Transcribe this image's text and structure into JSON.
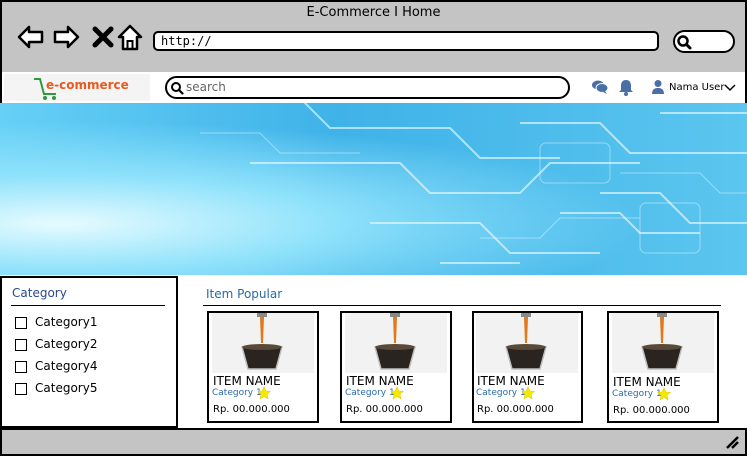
{
  "window": {
    "title": "E-Commerce I Home"
  },
  "browser": {
    "url": "http://",
    "nav_icons": [
      "back-icon",
      "forward-icon",
      "close-icon",
      "home-icon"
    ]
  },
  "header": {
    "logo_text": "e-commerce",
    "search_placeholder": "search",
    "user_name": "Nama User",
    "icons": [
      "chat-icon",
      "bell-icon",
      "user-icon",
      "chevron-down-icon"
    ]
  },
  "sidebar": {
    "title": "Category",
    "categories": [
      "Category1",
      "Category2",
      "Category4",
      "Category5"
    ]
  },
  "main": {
    "section_title": "Item Popular",
    "items": [
      {
        "name": "ITEM NAME",
        "category": "Category 1",
        "price": "Rp. 00.000.000"
      },
      {
        "name": "ITEM NAME",
        "category": "Category 1",
        "price": "Rp. 00.000.000"
      },
      {
        "name": "ITEM NAME",
        "category": "Category 1",
        "price": "Rp. 00.000.000"
      },
      {
        "name": "ITEM NAME",
        "category": "Category 1",
        "price": "Rp. 00.000.000"
      }
    ]
  },
  "colors": {
    "chrome": "#c4c4c4",
    "accent_blue": "#2a6aa8",
    "logo_green": "#2e9b3a",
    "logo_orange": "#e85a1f",
    "star": "#f5e800"
  }
}
